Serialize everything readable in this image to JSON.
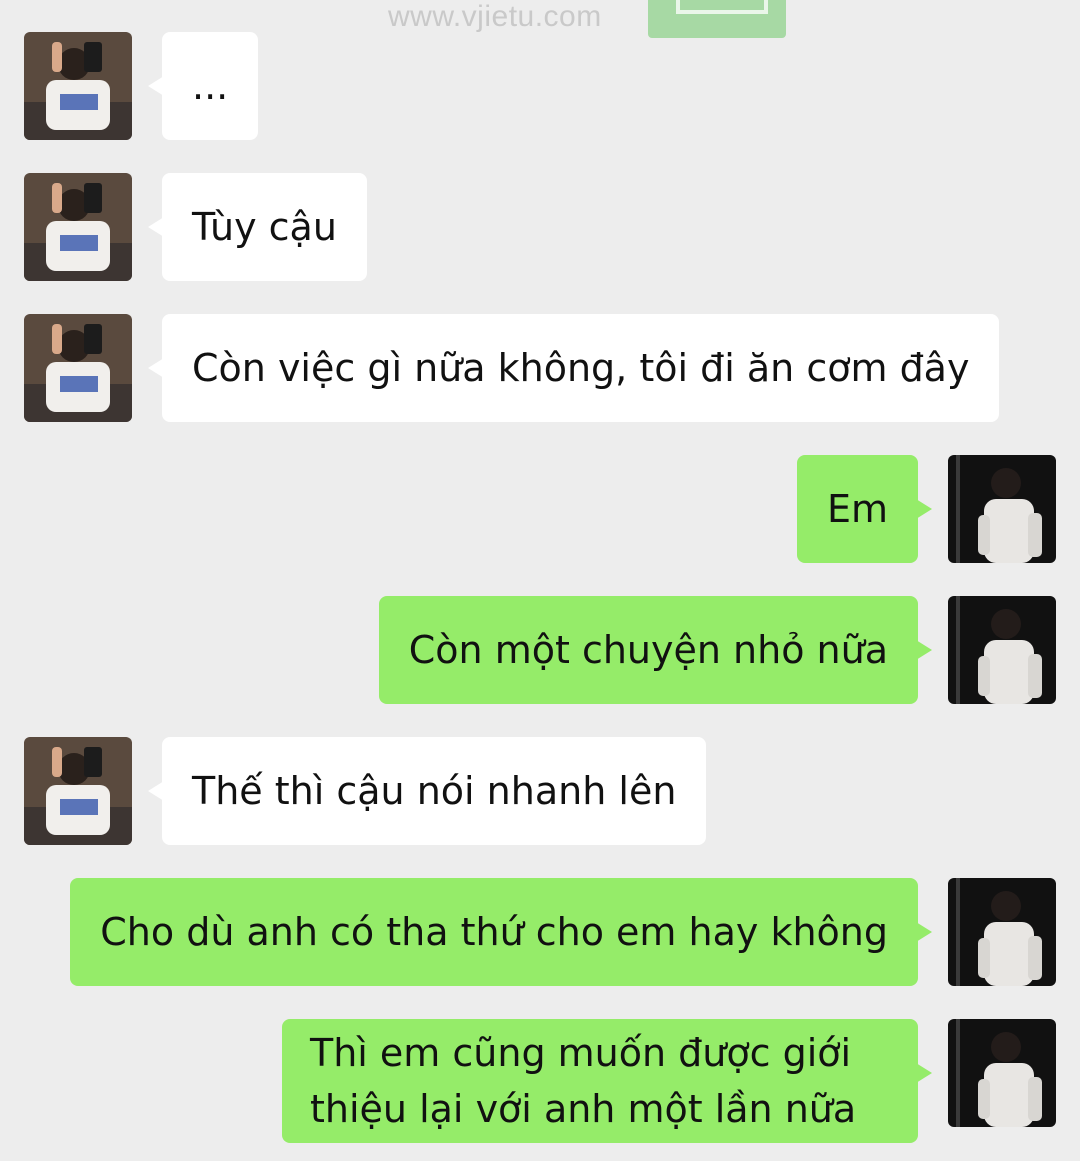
{
  "watermark": "www.vjietu.com",
  "contact": {
    "avatar_icon": "contact-avatar-icon"
  },
  "self": {
    "avatar_icon": "self-avatar-icon"
  },
  "colors": {
    "background": "#ededed",
    "sent_bubble": "#95ec69",
    "received_bubble": "#ffffff"
  },
  "messages": [
    {
      "side": "received",
      "text": "..."
    },
    {
      "side": "received",
      "text": "Tùy cậu"
    },
    {
      "side": "received",
      "text": "Còn việc gì nữa không, tôi đi ăn cơm đây"
    },
    {
      "side": "sent",
      "text": "Em"
    },
    {
      "side": "sent",
      "text": "Còn một chuyện nhỏ nữa"
    },
    {
      "side": "received",
      "text": "Thế thì cậu nói nhanh lên"
    },
    {
      "side": "sent",
      "text": "Cho dù anh có tha thứ cho em hay không"
    },
    {
      "side": "sent",
      "text": "Thì em cũng muốn được giới thiệu lại với anh một lần nữa"
    }
  ]
}
